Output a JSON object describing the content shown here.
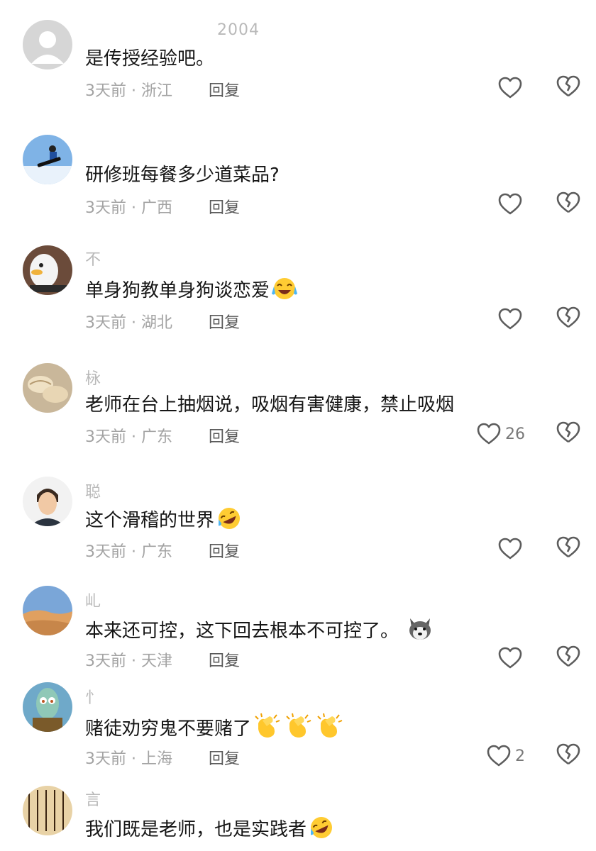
{
  "comments": [
    {
      "username": "2004",
      "text": "是传授经验吧。",
      "time": "3天前",
      "location": "浙江",
      "reply": "回复",
      "likes": "",
      "avatar": "default-avatar"
    },
    {
      "username": "",
      "text": "研修班每餐多少道菜品?",
      "time": "3天前",
      "location": "广西",
      "reply": "回复",
      "likes": "",
      "avatar": "snowboarder-avatar"
    },
    {
      "username": "不",
      "text": "单身狗教单身狗谈恋爱",
      "time": "3天前",
      "location": "湖北",
      "reply": "回复",
      "likes": "",
      "avatar": "duck-avatar",
      "emoji": [
        "crying-laughing-emoji"
      ]
    },
    {
      "username": "栐",
      "text": "老师在台上抽烟说，吸烟有害健康，禁止吸烟",
      "time": "3天前",
      "location": "广东",
      "reply": "回复",
      "likes": "26",
      "avatar": "dumpling-avatar"
    },
    {
      "username": "聪",
      "text": "这个滑稽的世界",
      "time": "3天前",
      "location": "广东",
      "reply": "回复",
      "likes": "",
      "avatar": "man-avatar",
      "emoji": [
        "rolling-laugh-emoji"
      ]
    },
    {
      "username": "乢",
      "text": "本来还可控，这下回去根本不可控了。",
      "time": "3天前",
      "location": "天津",
      "reply": "回复",
      "likes": "",
      "avatar": "desert-avatar",
      "emoji": [
        "husky-emoji"
      ]
    },
    {
      "username": "忄",
      "text": "赌徒劝穷鬼不要赌了",
      "time": "3天前",
      "location": "上海",
      "reply": "回复",
      "likes": "2",
      "avatar": "squidward-avatar",
      "emoji": [
        "clapping-emoji",
        "clapping-emoji",
        "clapping-emoji"
      ]
    },
    {
      "username": "言",
      "text": "我们既是老师，也是实践者",
      "time": "",
      "location": "",
      "reply": "",
      "likes": "",
      "avatar": "calligraphy-avatar",
      "emoji": [
        "rolling-laugh-emoji"
      ]
    }
  ],
  "meta_separator": "·",
  "colors": {
    "text": "#161616",
    "meta": "#a3a3a3",
    "reply": "#5a5a5a",
    "icon": "#5c5c5c"
  }
}
